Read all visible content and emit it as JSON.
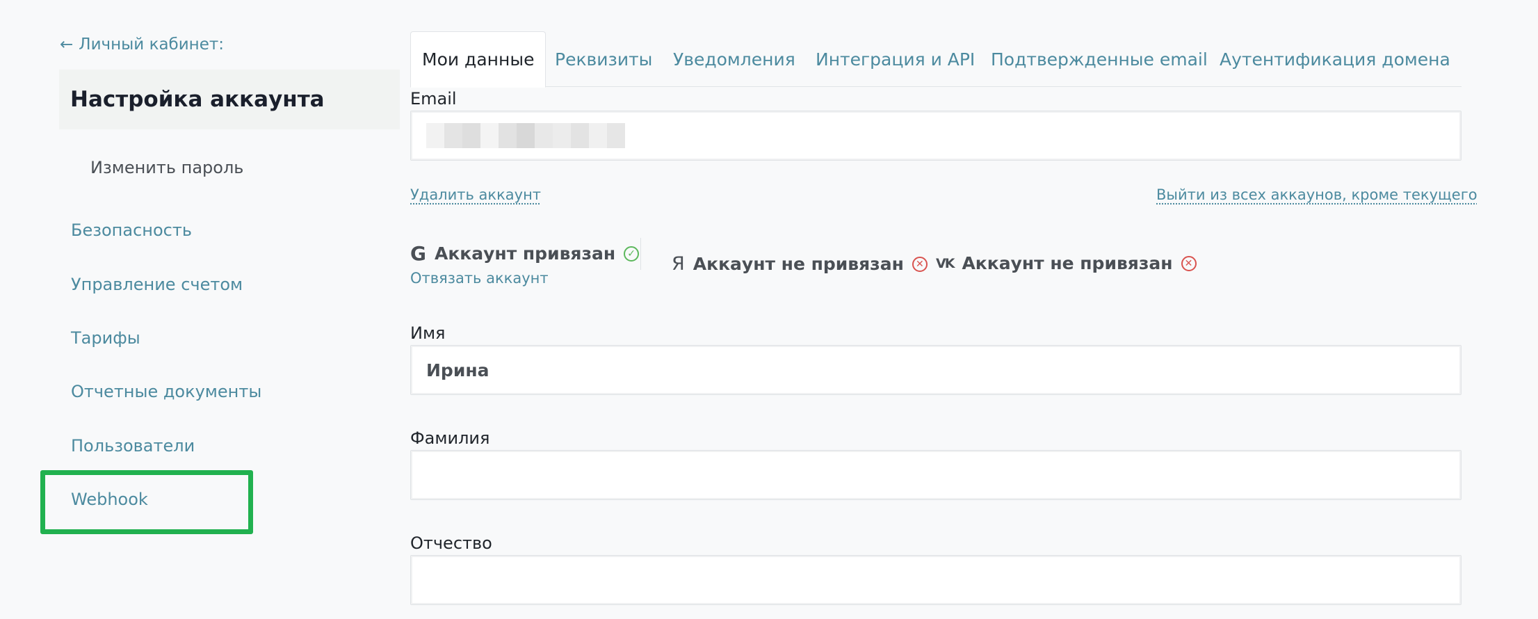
{
  "sidebar": {
    "back_label": "Личный кабинет:",
    "title": "Настройка аккаунта",
    "items": [
      {
        "label": "Изменить пароль"
      },
      {
        "label": "Безопасность"
      },
      {
        "label": "Управление счетом"
      },
      {
        "label": "Тарифы"
      },
      {
        "label": "Отчетные документы"
      },
      {
        "label": "Пользователи"
      },
      {
        "label": "Webhook"
      }
    ],
    "highlight_color": "#21b14f"
  },
  "tabs": [
    {
      "label": "Мои данные",
      "active": true
    },
    {
      "label": "Реквизиты"
    },
    {
      "label": "Уведомления"
    },
    {
      "label": "Интеграция и API"
    },
    {
      "label": "Подтвержденные email"
    },
    {
      "label": "Аутентификация домена"
    }
  ],
  "form": {
    "email_label": "Email",
    "delete_account": "Удалить аккаунт",
    "logout_others": "Выйти из всех аккаунов, кроме текущего",
    "social": [
      {
        "provider_icon": "google-icon",
        "status": "Аккаунт привязан",
        "state": "linked"
      },
      {
        "provider_icon": "yandex-icon",
        "status": "Аккаунт не привязан",
        "state": "unlinked"
      },
      {
        "provider_icon": "vk-icon",
        "status": "Аккаунт не привязан",
        "state": "unlinked"
      }
    ],
    "unlink_label": "Отвязать аккаунт",
    "first_name_label": "Имя",
    "first_name_value": "Ирина",
    "last_name_label": "Фамилия",
    "last_name_value": "",
    "middle_name_label": "Отчество",
    "middle_name_value": ""
  },
  "colors": {
    "link": "#4c8a9f",
    "ok": "#5cb85c",
    "error": "#d9534f"
  }
}
